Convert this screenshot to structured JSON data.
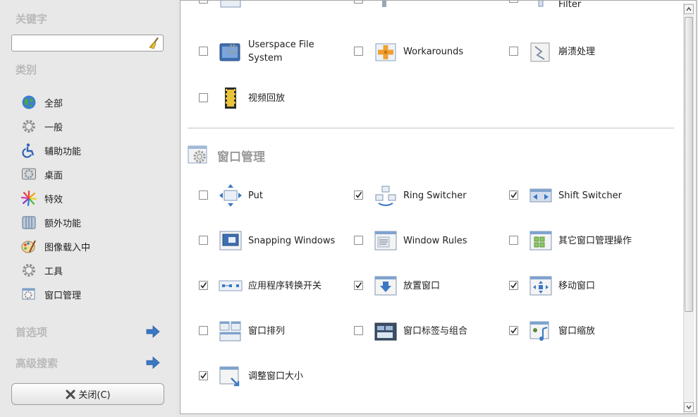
{
  "sidebar": {
    "keyword_heading": "关键字",
    "search": {
      "value": "",
      "placeholder": ""
    },
    "category_heading": "类别",
    "categories": [
      {
        "label": "全部",
        "icon": "globe-icon"
      },
      {
        "label": "一般",
        "icon": "gear-icon"
      },
      {
        "label": "辅助功能",
        "icon": "accessibility-icon"
      },
      {
        "label": "桌面",
        "icon": "desktop-icon"
      },
      {
        "label": "特效",
        "icon": "effects-icon"
      },
      {
        "label": "额外功能",
        "icon": "extras-icon"
      },
      {
        "label": "图像载入中",
        "icon": "image-loading-icon"
      },
      {
        "label": "工具",
        "icon": "tools-icon"
      },
      {
        "label": "窗口管理",
        "icon": "window-management-icon"
      }
    ],
    "preferences_label": "首选项",
    "advanced_search_label": "高级搜索",
    "close_button": {
      "label": "关闭(C)"
    }
  },
  "main": {
    "partial_top": [
      "Filter"
    ],
    "top_plugins": [
      {
        "label": "Userspace File System",
        "checked": false,
        "icon": "filesystem-icon"
      },
      {
        "label": "Workarounds",
        "checked": false,
        "icon": "workarounds-icon"
      },
      {
        "label": "崩溃处理",
        "checked": false,
        "icon": "crash-handler-icon"
      },
      {
        "label": "视频回放",
        "checked": false,
        "icon": "video-playback-icon"
      }
    ],
    "section_title": "窗口管理",
    "section_plugins": [
      {
        "label": "Put",
        "checked": false,
        "icon": "put-icon"
      },
      {
        "label": "Ring Switcher",
        "checked": true,
        "icon": "ring-switcher-icon"
      },
      {
        "label": "Shift Switcher",
        "checked": true,
        "icon": "shift-switcher-icon"
      },
      {
        "label": "Snapping Windows",
        "checked": false,
        "icon": "snapping-windows-icon"
      },
      {
        "label": "Window Rules",
        "checked": false,
        "icon": "window-rules-icon"
      },
      {
        "label": "其它窗口管理操作",
        "checked": false,
        "icon": "extra-wm-actions-icon"
      },
      {
        "label": "应用程序转换开关",
        "checked": true,
        "icon": "application-switcher-icon"
      },
      {
        "label": "放置窗口",
        "checked": true,
        "icon": "place-windows-icon"
      },
      {
        "label": "移动窗口",
        "checked": true,
        "icon": "move-window-icon"
      },
      {
        "label": "窗口排列",
        "checked": false,
        "icon": "scale-windows-icon"
      },
      {
        "label": "窗口标签与组合",
        "checked": false,
        "icon": "group-tab-icon"
      },
      {
        "label": "窗口缩放",
        "checked": true,
        "icon": "window-zoom-icon"
      },
      {
        "label": "调整窗口大小",
        "checked": true,
        "icon": "resize-window-icon"
      }
    ]
  },
  "colors": {
    "background": "#e6e6e6",
    "heading_gray": "#b9b9b9",
    "accent_blue": "#3b78c4"
  }
}
